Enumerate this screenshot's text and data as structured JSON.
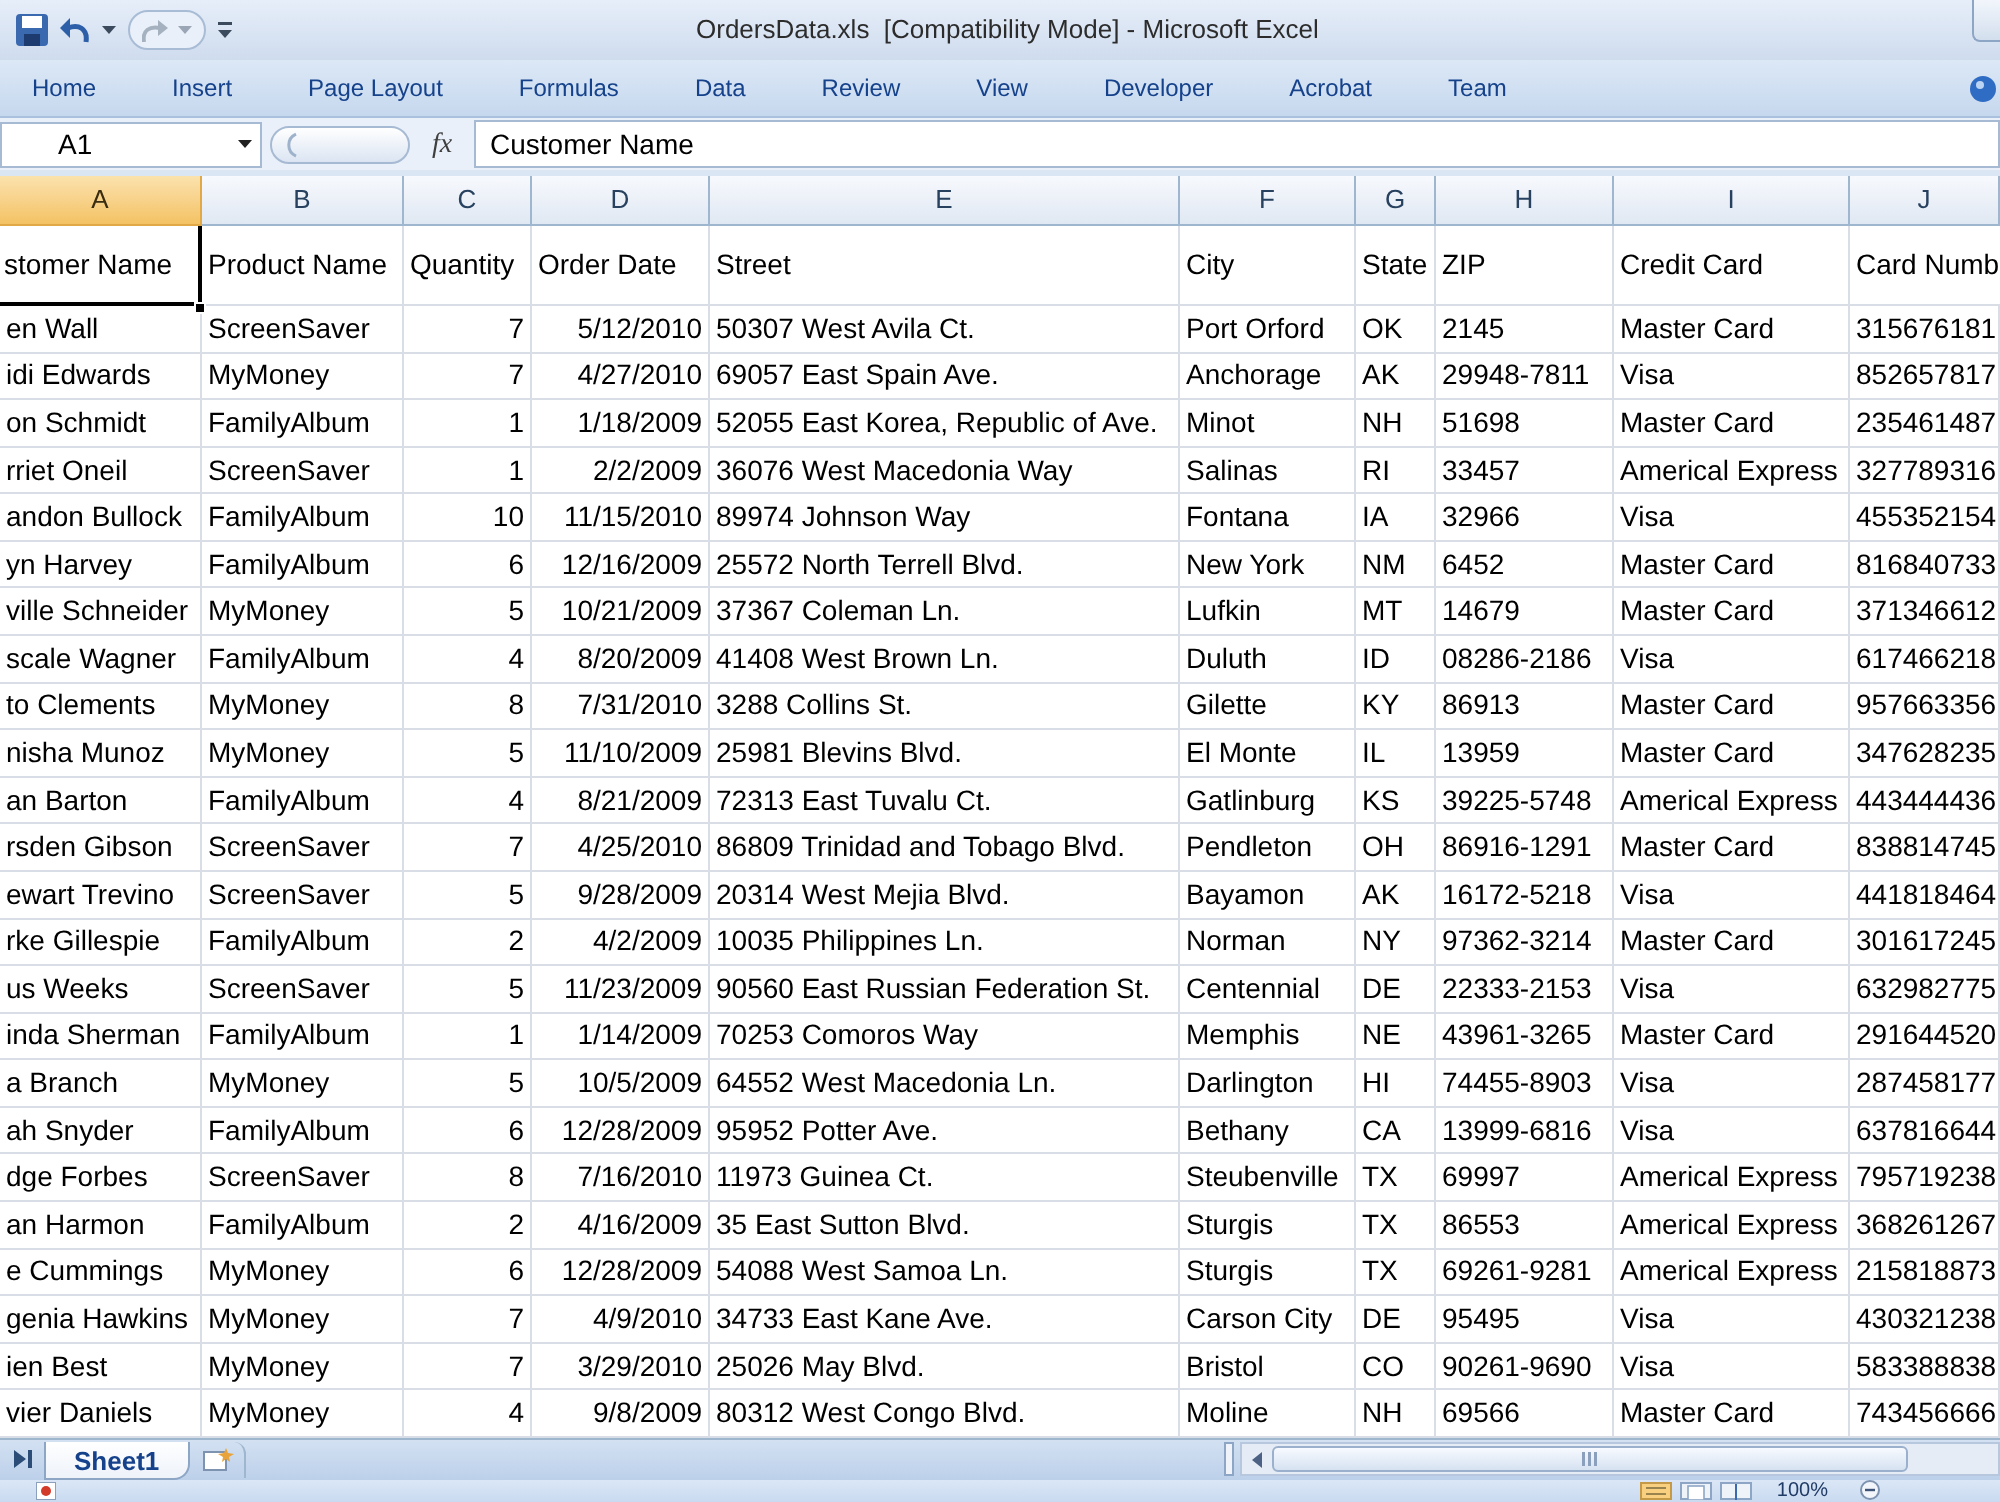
{
  "window": {
    "title": "OrdersData.xls  [Compatibility Mode] - Microsoft Excel"
  },
  "ribbon_tabs": [
    {
      "label": "Home",
      "selected": false
    },
    {
      "label": "Insert",
      "selected": false
    },
    {
      "label": "Page Layout",
      "selected": false
    },
    {
      "label": "Formulas",
      "selected": false
    },
    {
      "label": "Data",
      "selected": false
    },
    {
      "label": "Review",
      "selected": false
    },
    {
      "label": "View",
      "selected": false
    },
    {
      "label": "Developer",
      "selected": false
    },
    {
      "label": "Acrobat",
      "selected": false
    },
    {
      "label": "Team",
      "selected": false
    }
  ],
  "formula_bar": {
    "name_box": "A1",
    "function_button": "fx",
    "formula": "Customer Name"
  },
  "columns": [
    {
      "letter": "A",
      "selected": true,
      "kind": "text"
    },
    {
      "letter": "B",
      "selected": false,
      "kind": "text"
    },
    {
      "letter": "C",
      "selected": false,
      "kind": "number"
    },
    {
      "letter": "D",
      "selected": false,
      "kind": "number"
    },
    {
      "letter": "E",
      "selected": false,
      "kind": "text"
    },
    {
      "letter": "F",
      "selected": false,
      "kind": "text"
    },
    {
      "letter": "G",
      "selected": false,
      "kind": "text"
    },
    {
      "letter": "H",
      "selected": false,
      "kind": "text"
    },
    {
      "letter": "I",
      "selected": false,
      "kind": "text"
    },
    {
      "letter": "J",
      "selected": false,
      "kind": "text"
    }
  ],
  "header_row": [
    {
      "text": "stomer Name",
      "selected": true
    },
    {
      "text": "Product Name",
      "selected": false
    },
    {
      "text": "Quantity",
      "selected": false
    },
    {
      "text": "Order Date",
      "selected": false
    },
    {
      "text": "Street",
      "selected": false
    },
    {
      "text": "City",
      "selected": false
    },
    {
      "text": "State",
      "selected": false
    },
    {
      "text": "ZIP",
      "selected": false
    },
    {
      "text": "Credit Card",
      "selected": false
    },
    {
      "text": "Card Numb",
      "selected": false
    }
  ],
  "rows": [
    [
      "en Wall",
      "ScreenSaver",
      "7",
      "5/12/2010",
      "50307 West Avila Ct.",
      "Port Orford",
      "OK",
      "2145",
      "Master Card",
      "315676181"
    ],
    [
      "idi Edwards",
      "MyMoney",
      "7",
      "4/27/2010",
      "69057 East Spain Ave.",
      "Anchorage",
      "AK",
      "29948-7811",
      "Visa",
      "852657817"
    ],
    [
      "on Schmidt",
      "FamilyAlbum",
      "1",
      "1/18/2009",
      "52055 East Korea, Republic of Ave.",
      "Minot",
      "NH",
      "51698",
      "Master Card",
      "235461487"
    ],
    [
      "rriet Oneil",
      "ScreenSaver",
      "1",
      "2/2/2009",
      "36076 West Macedonia Way",
      "Salinas",
      "RI",
      "33457",
      "Americal Express",
      "327789316"
    ],
    [
      "andon Bullock",
      "FamilyAlbum",
      "10",
      "11/15/2010",
      "89974 Johnson Way",
      "Fontana",
      "IA",
      "32966",
      "Visa",
      "455352154"
    ],
    [
      "yn Harvey",
      "FamilyAlbum",
      "6",
      "12/16/2009",
      "25572 North Terrell Blvd.",
      "New York",
      "NM",
      "6452",
      "Master Card",
      "816840733"
    ],
    [
      "ville Schneider",
      "MyMoney",
      "5",
      "10/21/2009",
      "37367 Coleman Ln.",
      "Lufkin",
      "MT",
      "14679",
      "Master Card",
      "371346612"
    ],
    [
      "scale Wagner",
      "FamilyAlbum",
      "4",
      "8/20/2009",
      "41408 West Brown Ln.",
      "Duluth",
      "ID",
      "08286-2186",
      "Visa",
      "617466218"
    ],
    [
      "to Clements",
      "MyMoney",
      "8",
      "7/31/2010",
      "3288 Collins St.",
      "Gilette",
      "KY",
      "86913",
      "Master Card",
      "957663356"
    ],
    [
      "nisha Munoz",
      "MyMoney",
      "5",
      "11/10/2009",
      "25981 Blevins Blvd.",
      "El Monte",
      "IL",
      "13959",
      "Master Card",
      "347628235"
    ],
    [
      "an Barton",
      "FamilyAlbum",
      "4",
      "8/21/2009",
      "72313 East Tuvalu Ct.",
      "Gatlinburg",
      "KS",
      "39225-5748",
      "Americal Express",
      "443444436"
    ],
    [
      "rsden Gibson",
      "ScreenSaver",
      "7",
      "4/25/2010",
      "86809 Trinidad and Tobago Blvd.",
      "Pendleton",
      "OH",
      "86916-1291",
      "Master Card",
      "838814745"
    ],
    [
      "ewart Trevino",
      "ScreenSaver",
      "5",
      "9/28/2009",
      "20314 West Mejia Blvd.",
      "Bayamon",
      "AK",
      "16172-5218",
      "Visa",
      "441818464"
    ],
    [
      "rke Gillespie",
      "FamilyAlbum",
      "2",
      "4/2/2009",
      "10035 Philippines Ln.",
      "Norman",
      "NY",
      "97362-3214",
      "Master Card",
      "301617245"
    ],
    [
      "us Weeks",
      "ScreenSaver",
      "5",
      "11/23/2009",
      "90560 East Russian Federation St.",
      "Centennial",
      "DE",
      "22333-2153",
      "Visa",
      "632982775"
    ],
    [
      "inda Sherman",
      "FamilyAlbum",
      "1",
      "1/14/2009",
      "70253 Comoros Way",
      "Memphis",
      "NE",
      "43961-3265",
      "Master Card",
      "291644520"
    ],
    [
      "a Branch",
      "MyMoney",
      "5",
      "10/5/2009",
      "64552 West Macedonia Ln.",
      "Darlington",
      "HI",
      "74455-8903",
      "Visa",
      "287458177"
    ],
    [
      "ah Snyder",
      "FamilyAlbum",
      "6",
      "12/28/2009",
      "95952 Potter Ave.",
      "Bethany",
      "CA",
      "13999-6816",
      "Visa",
      "637816644"
    ],
    [
      "dge Forbes",
      "ScreenSaver",
      "8",
      "7/16/2010",
      "11973 Guinea Ct.",
      "Steubenville",
      "TX",
      "69997",
      "Americal Express",
      "795719238"
    ],
    [
      "an Harmon",
      "FamilyAlbum",
      "2",
      "4/16/2009",
      "35 East Sutton Blvd.",
      "Sturgis",
      "TX",
      "86553",
      "Americal Express",
      "368261267"
    ],
    [
      "e Cummings",
      "MyMoney",
      "6",
      "12/28/2009",
      "54088 West Samoa Ln.",
      "Sturgis",
      "TX",
      "69261-9281",
      "Americal Express",
      "215818873"
    ],
    [
      "genia Hawkins",
      "MyMoney",
      "7",
      "4/9/2010",
      "34733 East Kane Ave.",
      "Carson City",
      "DE",
      "95495",
      "Visa",
      "430321238"
    ],
    [
      "ien Best",
      "MyMoney",
      "7",
      "3/29/2010",
      "25026 May Blvd.",
      "Bristol",
      "CO",
      "90261-9690",
      "Visa",
      "583388838"
    ],
    [
      "vier Daniels",
      "MyMoney",
      "4",
      "9/8/2009",
      "80312 West Congo Blvd.",
      "Moline",
      "NH",
      "69566",
      "Master Card",
      "743456666"
    ]
  ],
  "sheet_tabs": [
    {
      "label": "Sheet1",
      "selected": true
    }
  ],
  "status_bar": {
    "zoom": "100%"
  }
}
